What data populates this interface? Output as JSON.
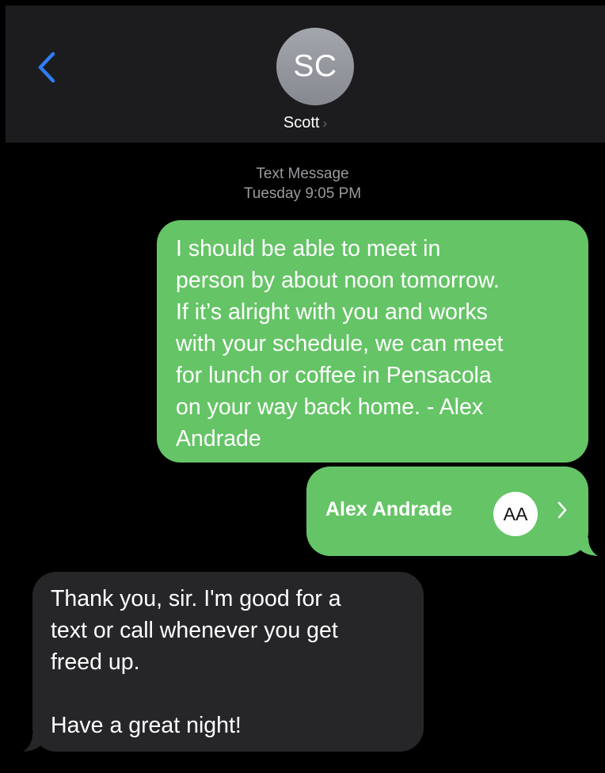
{
  "header": {
    "back_icon": "chevron-left-icon",
    "avatar_initials": "SC",
    "contact_name": "Scott",
    "contact_chevron": "›"
  },
  "conversation": {
    "service_label": "Text Message",
    "timestamp": "Tuesday 9:05 PM"
  },
  "messages": [
    {
      "direction": "sent",
      "lines": [
        "I should be able to meet in",
        "person by about noon tomorrow.",
        "If it’s alright with you and works",
        "with your schedule, we can meet",
        "for lunch or coffee in Pensacola",
        "on your way back home. - Alex",
        "Andrade"
      ]
    },
    {
      "direction": "sent",
      "type": "contact-card",
      "name": "Alex Andrade",
      "initials": "AA"
    },
    {
      "direction": "received",
      "lines": [
        "Thank you, sir.  I'm good for a",
        "text or call whenever you get",
        "freed up.",
        "",
        "Have a great night!"
      ]
    }
  ],
  "colors": {
    "sent_bubble": "#65c466",
    "received_bubble": "#262629",
    "header_bg": "#1c1c1e",
    "accent_blue": "#2f7cf6",
    "timestamp_text": "#9b9ba0"
  }
}
